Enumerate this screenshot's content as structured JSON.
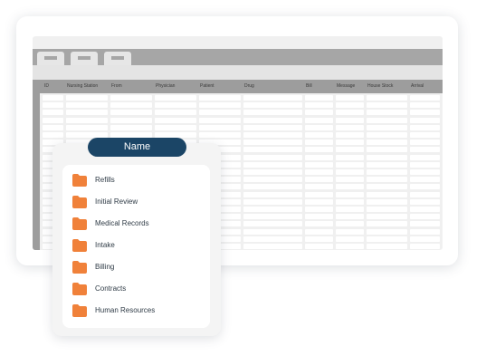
{
  "table": {
    "columns": [
      "ID",
      "Nursing Station",
      "From",
      "Physician",
      "Patient",
      "Drug",
      "Bill",
      "Message",
      "House Stock",
      "Arrival"
    ]
  },
  "panel": {
    "title": "Name",
    "folders": [
      "Refills",
      "Initial Review",
      "Medical Records",
      "Intake",
      "Billing",
      "Contracts",
      "Human Resources"
    ]
  },
  "colors": {
    "pill": "#1b4566",
    "folder": "#f0813a",
    "header": "#9d9d9d"
  },
  "icons": {
    "folder": "folder-icon"
  }
}
